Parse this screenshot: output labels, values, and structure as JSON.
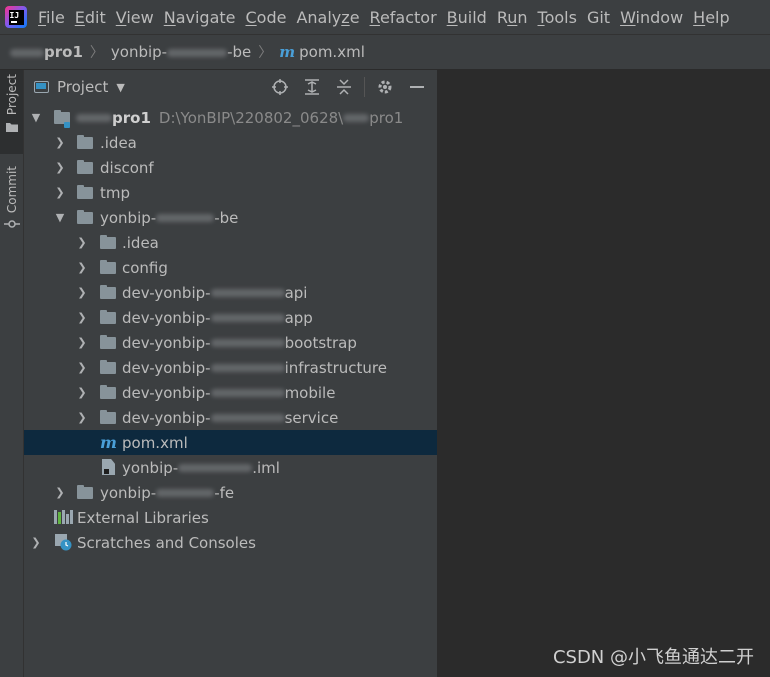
{
  "menubar": {
    "logo_text": "IJ",
    "items": [
      {
        "pre": "",
        "u": "F",
        "post": "ile"
      },
      {
        "pre": "",
        "u": "E",
        "post": "dit"
      },
      {
        "pre": "",
        "u": "V",
        "post": "iew"
      },
      {
        "pre": "",
        "u": "N",
        "post": "avigate"
      },
      {
        "pre": "",
        "u": "C",
        "post": "ode"
      },
      {
        "pre": "Analy",
        "u": "z",
        "post": "e"
      },
      {
        "pre": "",
        "u": "R",
        "post": "efactor"
      },
      {
        "pre": "",
        "u": "B",
        "post": "uild"
      },
      {
        "pre": "R",
        "u": "u",
        "post": "n"
      },
      {
        "pre": "",
        "u": "T",
        "post": "ools"
      },
      {
        "pre": "Git",
        "u": "",
        "post": ""
      },
      {
        "pre": "",
        "u": "W",
        "post": "indow"
      },
      {
        "pre": "",
        "u": "H",
        "post": "elp"
      }
    ]
  },
  "breadcrumb": {
    "project_suffix": "pro1",
    "module_prefix": "yonbip-",
    "module_suffix": "-be",
    "file_icon": "maven-icon",
    "file_icon_glyph": "m",
    "file": "pom.xml"
  },
  "tool_strip": {
    "project_tab": "Project",
    "commit_tab": "Commit"
  },
  "project_panel": {
    "title": "Project",
    "tools": [
      "locate-icon",
      "expand-all-icon",
      "collapse-all-icon",
      "settings-icon",
      "hide-icon"
    ]
  },
  "tree": {
    "root_suffix": "pro1",
    "root_path_prefix": "D:\\YonBIP\\220802_0628\\",
    "root_path_suffix": "pro1",
    "idea": ".idea",
    "disconf": "disconf",
    "tmp": "tmp",
    "be_prefix": "yonbip-",
    "be_suffix": "-be",
    "be_idea": ".idea",
    "be_config": "config",
    "dev_prefix": "dev-yonbip-",
    "dev_api": "api",
    "dev_app": "app",
    "dev_bootstrap": "bootstrap",
    "dev_infrastructure": "infrastructure",
    "dev_mobile": "mobile",
    "dev_service": "service",
    "pom": "pom.xml",
    "pom_icon": "m",
    "iml_prefix": "yonbip-",
    "iml_suffix": ".iml",
    "fe_prefix": "yonbip-",
    "fe_suffix": "-fe",
    "external_libraries": "External Libraries",
    "scratches": "Scratches and Consoles"
  },
  "watermark": "CSDN @小飞鱼通达二开",
  "colors": {
    "background": "#2b2b2b",
    "panel": "#3c3f41",
    "selection": "#0d293e",
    "folder": "#87939a",
    "accent": "#3592c4"
  }
}
